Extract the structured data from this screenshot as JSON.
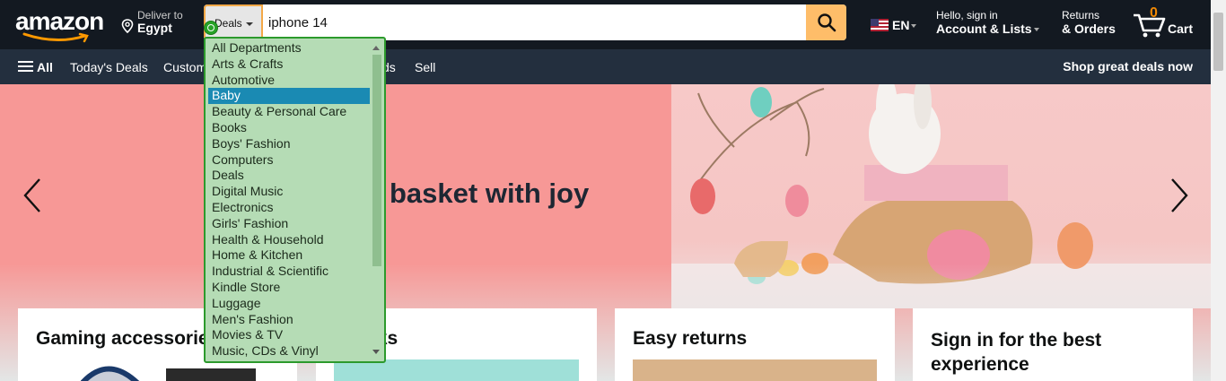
{
  "header": {
    "logo_text": "amazon",
    "deliver_line1": "Deliver to",
    "deliver_line2": "Egypt",
    "search_category": "Deals",
    "search_value": "iphone 14",
    "language": "EN",
    "account_line1": "Hello, sign in",
    "account_line2": "Account & Lists",
    "returns_line1": "Returns",
    "returns_line2": "& Orders",
    "cart_count": "0",
    "cart_label": "Cart"
  },
  "subnav": {
    "all_label": "All",
    "items": [
      "Today's Deals",
      "Custom",
      "ds",
      "Sell"
    ],
    "promo": "Shop great deals now"
  },
  "hero": {
    "headline": "basket with joy"
  },
  "cards": [
    {
      "title": "Gaming accessorie"
    },
    {
      "title": "y picks"
    },
    {
      "title": "Easy returns"
    },
    {
      "title": "Sign in for the best experience"
    }
  ],
  "dropdown": {
    "selected": "Baby",
    "options": [
      "All Departments",
      "Arts & Crafts",
      "Automotive",
      "Baby",
      "Beauty & Personal Care",
      "Books",
      "Boys' Fashion",
      "Computers",
      "Deals",
      "Digital Music",
      "Electronics",
      "Girls' Fashion",
      "Health & Household",
      "Home & Kitchen",
      "Industrial & Scientific",
      "Kindle Store",
      "Luggage",
      "Men's Fashion",
      "Movies & TV",
      "Music, CDs & Vinyl"
    ]
  },
  "colors": {
    "nav_bg": "#131921",
    "subnav_bg": "#232f3e",
    "search_button": "#febd69",
    "cart_count": "#f08804",
    "hero_bg": "#f79896",
    "dropdown_bg": "#b5dcb5",
    "dropdown_selected": "#1a8ab3"
  }
}
